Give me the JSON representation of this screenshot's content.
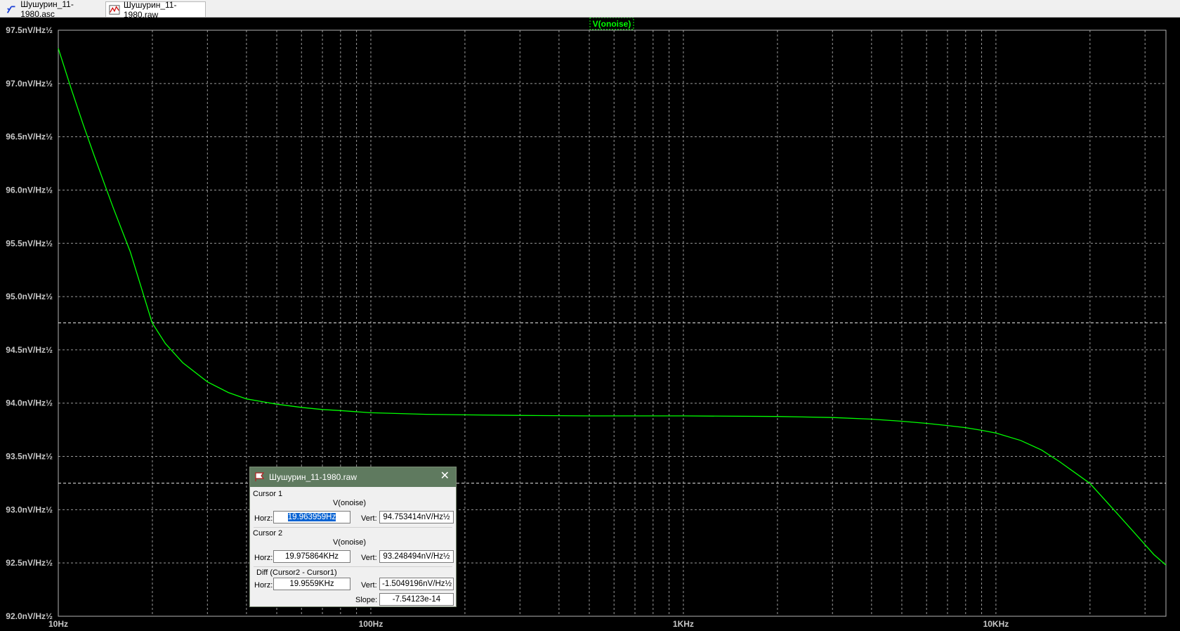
{
  "tabs": [
    {
      "label": "Шушурин_11-1980.asc",
      "icon": "schematic-icon",
      "active": false
    },
    {
      "label": "Шушурин_11-1980.raw",
      "icon": "waveform-icon",
      "active": true
    }
  ],
  "plot": {
    "trace_label": "V(onoise)",
    "trace_color": "#00ff00",
    "grid_color": "#9a9a9a"
  },
  "chart_data": {
    "type": "line",
    "title": "V(onoise)",
    "x_scale": "log",
    "xlim": [
      10,
      35000
    ],
    "ylim": [
      92.0,
      97.5
    ],
    "x_ticks": [
      "10Hz",
      "100Hz",
      "1KHz",
      "10KHz"
    ],
    "y_ticks": [
      "92.0nV/Hz½",
      "92.5nV/Hz½",
      "93.0nV/Hz½",
      "93.5nV/Hz½",
      "94.0nV/Hz½",
      "94.5nV/Hz½",
      "95.0nV/Hz½",
      "95.5nV/Hz½",
      "96.0nV/Hz½",
      "96.5nV/Hz½",
      "97.0nV/Hz½",
      "97.5nV/Hz½"
    ],
    "grid": true,
    "series": [
      {
        "name": "V(onoise)",
        "x": [
          10,
          11,
          12,
          13,
          14,
          15,
          17,
          19.96,
          22,
          25,
          30,
          35,
          40,
          50,
          60,
          70,
          80,
          100,
          150,
          200,
          300,
          500,
          1000,
          2000,
          3000,
          4000,
          5000,
          6000,
          7000,
          8000,
          9000,
          10000,
          12000,
          14000,
          16000,
          19976,
          24000,
          28000,
          32000,
          35000
        ],
        "y": [
          97.33,
          96.95,
          96.62,
          96.33,
          96.07,
          95.83,
          95.42,
          94.753,
          94.56,
          94.38,
          94.2,
          94.1,
          94.04,
          93.99,
          93.96,
          93.94,
          93.93,
          93.91,
          93.895,
          93.89,
          93.885,
          93.88,
          93.88,
          93.875,
          93.865,
          93.85,
          93.83,
          93.81,
          93.79,
          93.77,
          93.745,
          93.72,
          93.65,
          93.56,
          93.45,
          93.248,
          92.99,
          92.77,
          92.58,
          92.48
        ]
      }
    ],
    "cursors": [
      {
        "x": 19.963959,
        "y": 94.753414
      },
      {
        "x": 19975.864,
        "y": 93.248494
      }
    ]
  },
  "cursor_window": {
    "title": "Шушурин_11-1980.raw",
    "cursor1": {
      "label": "Cursor 1",
      "signal": "V(onoise)",
      "horz_label": "Horz:",
      "horz": "19.963959Hz",
      "vert_label": "Vert:",
      "vert": "94.753414nV/Hz½"
    },
    "cursor2": {
      "label": "Cursor 2",
      "signal": "V(onoise)",
      "horz_label": "Horz:",
      "horz": "19.975864KHz",
      "vert_label": "Vert:",
      "vert": "93.248494nV/Hz½"
    },
    "diff": {
      "label": "Diff (Cursor2 - Cursor1)",
      "horz_label": "Horz:",
      "horz": "19.9559KHz",
      "vert_label": "Vert:",
      "vert": "-1.5049196nV/Hz½",
      "slope_label": "Slope:",
      "slope": "-7.54123e-14"
    }
  }
}
